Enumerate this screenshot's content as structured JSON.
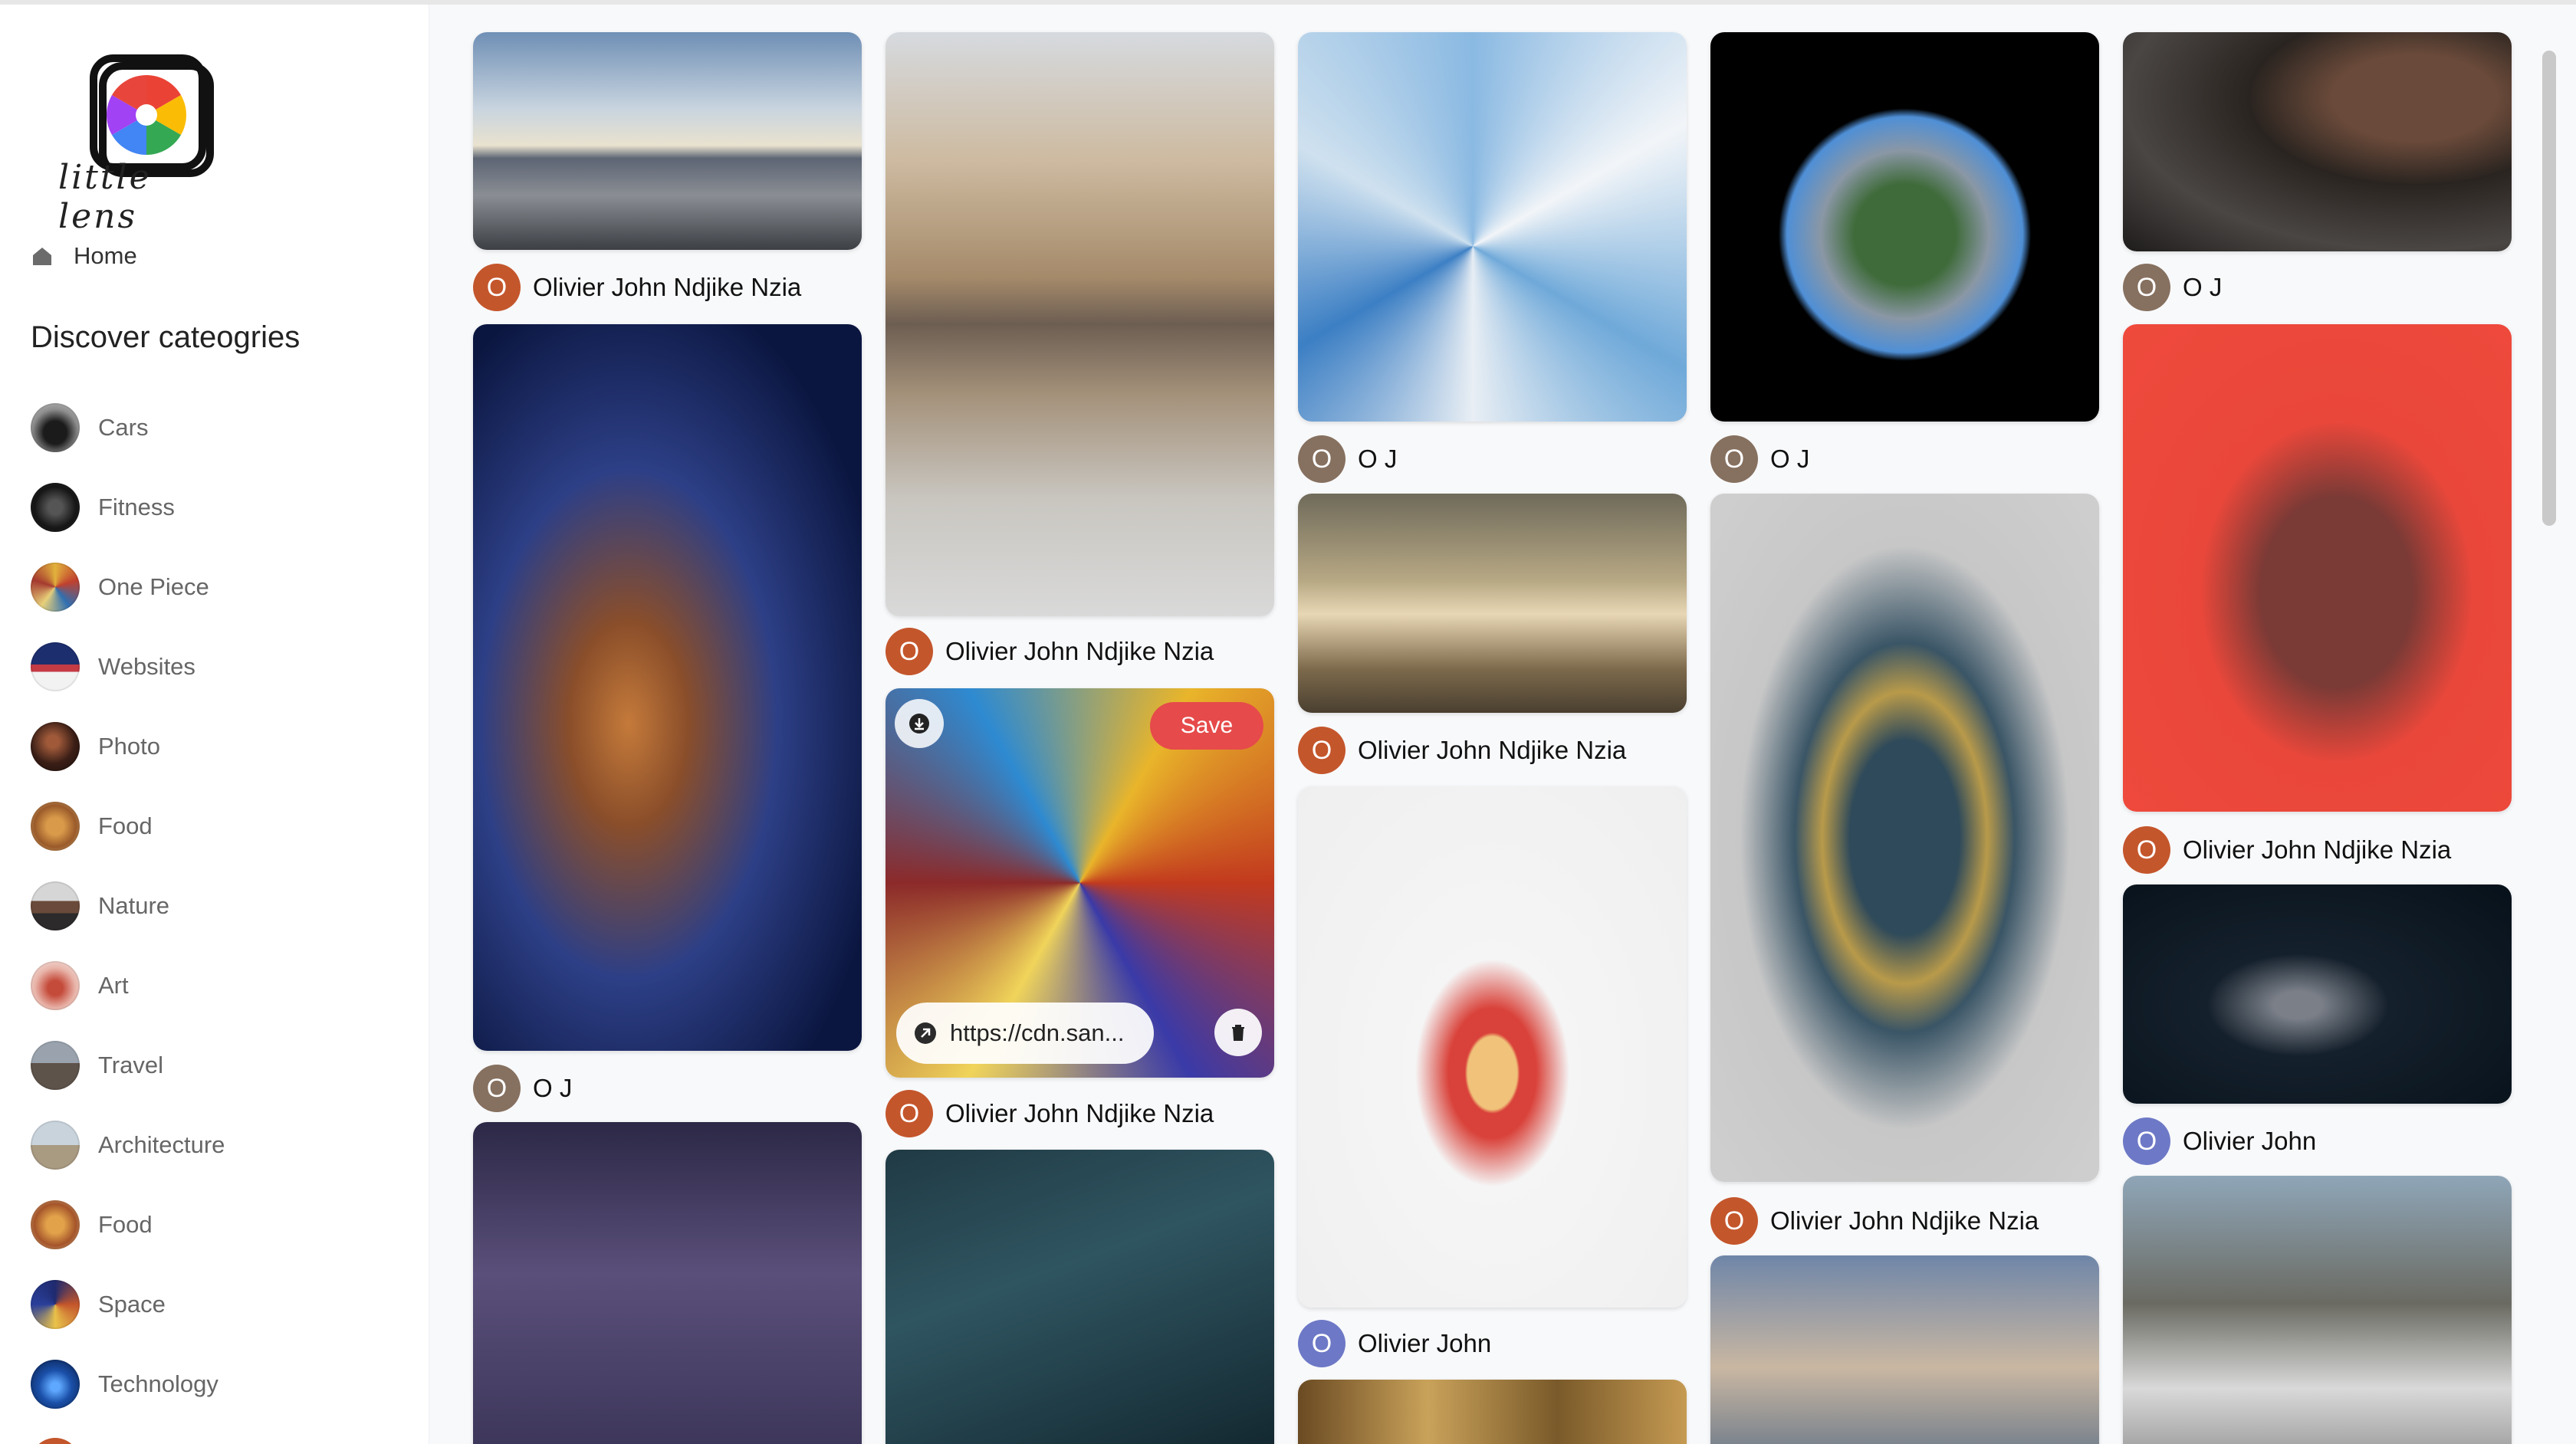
{
  "app": {
    "logo_text": "little lens"
  },
  "sidebar": {
    "home_label": "Home",
    "discover_title": "Discover cateogries",
    "categories": [
      {
        "label": "Cars"
      },
      {
        "label": "Fitness"
      },
      {
        "label": "One Piece"
      },
      {
        "label": "Websites"
      },
      {
        "label": "Photo"
      },
      {
        "label": "Food"
      },
      {
        "label": "Nature"
      },
      {
        "label": "Art"
      },
      {
        "label": "Travel"
      },
      {
        "label": "Architecture"
      },
      {
        "label": "Food"
      },
      {
        "label": "Space"
      },
      {
        "label": "Technology"
      }
    ]
  },
  "feed": {
    "initial": "O",
    "authors": {
      "full": "Olivier John Ndjike Nzia",
      "short": "O J",
      "medium": "Olivier John"
    },
    "hover_pin": {
      "save_label": "Save",
      "link_text": "https://cdn.san..."
    }
  },
  "colors": {
    "accent_red": "#e64a4a",
    "avatar_red": "#c4562c",
    "avatar_brown": "#86705f",
    "avatar_blue": "#6d79c6"
  }
}
